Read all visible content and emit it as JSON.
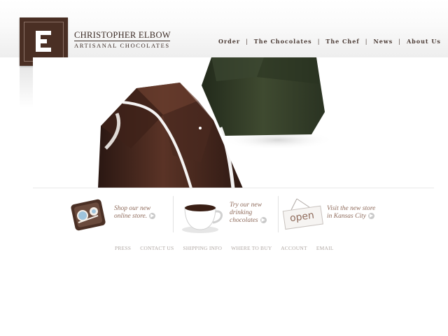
{
  "brand": {
    "name": "CHRISTOPHER ELBOW",
    "tagline": "ARTISANAL CHOCOLATES",
    "logo_letter": "E"
  },
  "nav": {
    "items": [
      "Order",
      "The Chocolates",
      "The Chef",
      "News",
      "About Us"
    ],
    "separator": "|"
  },
  "hero": {
    "image": "chocolate-truffles-photo"
  },
  "promos": [
    {
      "line1": "Shop our new",
      "line2": "online store.",
      "icon": "chocolate-box-icon"
    },
    {
      "line1": "Try our new",
      "line2": "drinking",
      "line3": "chocolates",
      "icon": "cocoa-cup-icon"
    },
    {
      "line1": "Visit the new store",
      "line2": "in Kansas City",
      "icon": "open-sign-icon",
      "sign_text": "open"
    }
  ],
  "footer": {
    "links": [
      "PRESS",
      "CONTACT US",
      "SHIPPING INFO",
      "WHERE TO BUY",
      "ACCOUNT",
      "EMAIL"
    ]
  },
  "colors": {
    "brand_brown": "#4a2f24",
    "promo_text": "#8e6a5a",
    "footer_text": "#b0a8a4"
  }
}
